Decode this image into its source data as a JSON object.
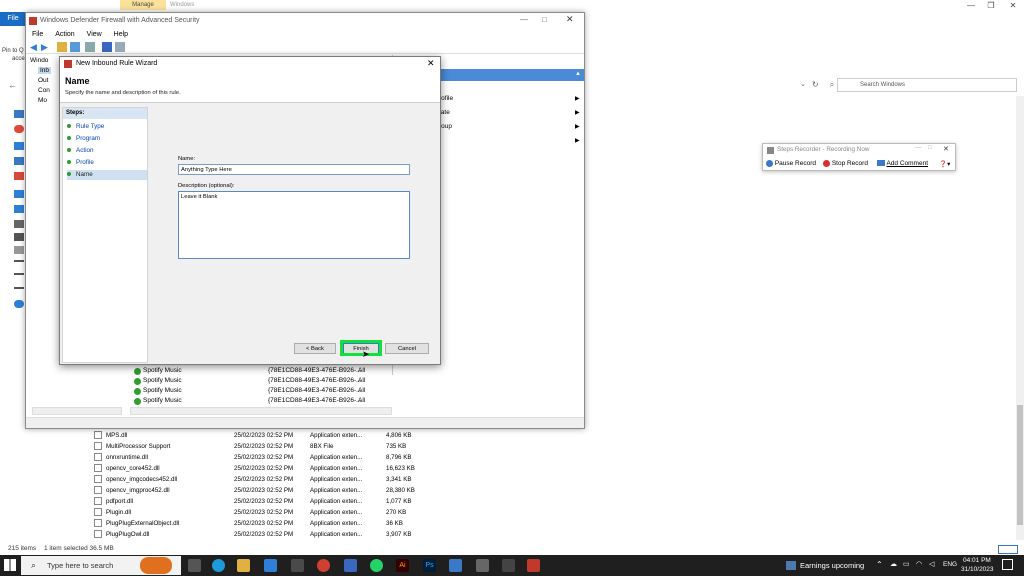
{
  "explorer": {
    "file_tab": "File",
    "manage_tab": "Manage",
    "windows_tab": "Windows",
    "pin_label": "Pin to Q",
    "access_label": "acces",
    "search_placeholder": "Search Windows",
    "status_items": "215 items",
    "status_selected": "1 item selected  36.5 MB",
    "files": [
      {
        "name": "MPS.dll",
        "date": "25/02/2023 02:52 PM",
        "type": "Application exten...",
        "size": "4,806 KB"
      },
      {
        "name": "MultiProcessor Support",
        "date": "25/02/2023 02:52 PM",
        "type": "8BX File",
        "size": "735 KB"
      },
      {
        "name": "onnxruntime.dll",
        "date": "25/02/2023 02:52 PM",
        "type": "Application exten...",
        "size": "8,796 KB"
      },
      {
        "name": "opencv_core452.dll",
        "date": "25/02/2023 02:52 PM",
        "type": "Application exten...",
        "size": "16,623 KB"
      },
      {
        "name": "opencv_imgcodecs452.dll",
        "date": "25/02/2023 02:52 PM",
        "type": "Application exten...",
        "size": "3,341 KB"
      },
      {
        "name": "opencv_imgproc452.dll",
        "date": "25/02/2023 02:52 PM",
        "type": "Application exten...",
        "size": "28,380 KB"
      },
      {
        "name": "pdfport.dll",
        "date": "25/02/2023 02:52 PM",
        "type": "Application exten...",
        "size": "1,077 KB"
      },
      {
        "name": "Plugin.dll",
        "date": "25/02/2023 02:52 PM",
        "type": "Application exten...",
        "size": "270 KB"
      },
      {
        "name": "PlugPlugExternalObject.dll",
        "date": "25/02/2023 02:52 PM",
        "type": "Application exten...",
        "size": "36 KB"
      },
      {
        "name": "PlugPlugOwl.dll",
        "date": "25/02/2023 02:52 PM",
        "type": "Application exten...",
        "size": "3,907 KB"
      }
    ]
  },
  "firewall": {
    "title": "Windows Defender Firewall with Advanced Security",
    "menu": [
      "File",
      "Action",
      "View",
      "Help"
    ],
    "tree": [
      "Windo",
      "Inb",
      "Out",
      "Con",
      "Mo"
    ],
    "actions": [
      "rofile",
      "tate",
      "roup",
      ""
    ],
    "rules": [
      {
        "name": "Spotify Music",
        "id": "{78E1CD88-49E3-476E-B926-...",
        "profile": "All"
      },
      {
        "name": "Spotify Music",
        "id": "{78E1CD88-49E3-476E-B926-...",
        "profile": "All"
      },
      {
        "name": "Spotify Music",
        "id": "{78E1CD88-49E3-476E-B926-...",
        "profile": "All"
      },
      {
        "name": "Spotify Music",
        "id": "{78E1CD88-49E3-476E-B926-...",
        "profile": "All"
      }
    ]
  },
  "wizard": {
    "title": "New Inbound Rule Wizard",
    "heading": "Name",
    "subheading": "Specify the name and description of this rule.",
    "steps_label": "Steps:",
    "steps": [
      "Rule Type",
      "Program",
      "Action",
      "Profile",
      "Name"
    ],
    "name_label": "Name:",
    "name_value": "Anything Type Here",
    "description_label": "Description (optional):",
    "description_value": "Leave it Blank",
    "back_label": "< Back",
    "finish_label": "Finish",
    "cancel_label": "Cancel"
  },
  "steps_recorder": {
    "title": "Steps Recorder - Recording Now",
    "pause": "Pause Record",
    "stop": "Stop Record",
    "add_comment": "Add Comment"
  },
  "taskbar": {
    "search_placeholder": "Type here to search",
    "weather": "Earnings upcoming",
    "lang": "ENG",
    "time": "04:01 PM",
    "date": "31/10/2023"
  },
  "colors": {
    "accent": "#1a6dc4",
    "highlight": "#13e13a",
    "taskbar": "#1f1f1f"
  }
}
